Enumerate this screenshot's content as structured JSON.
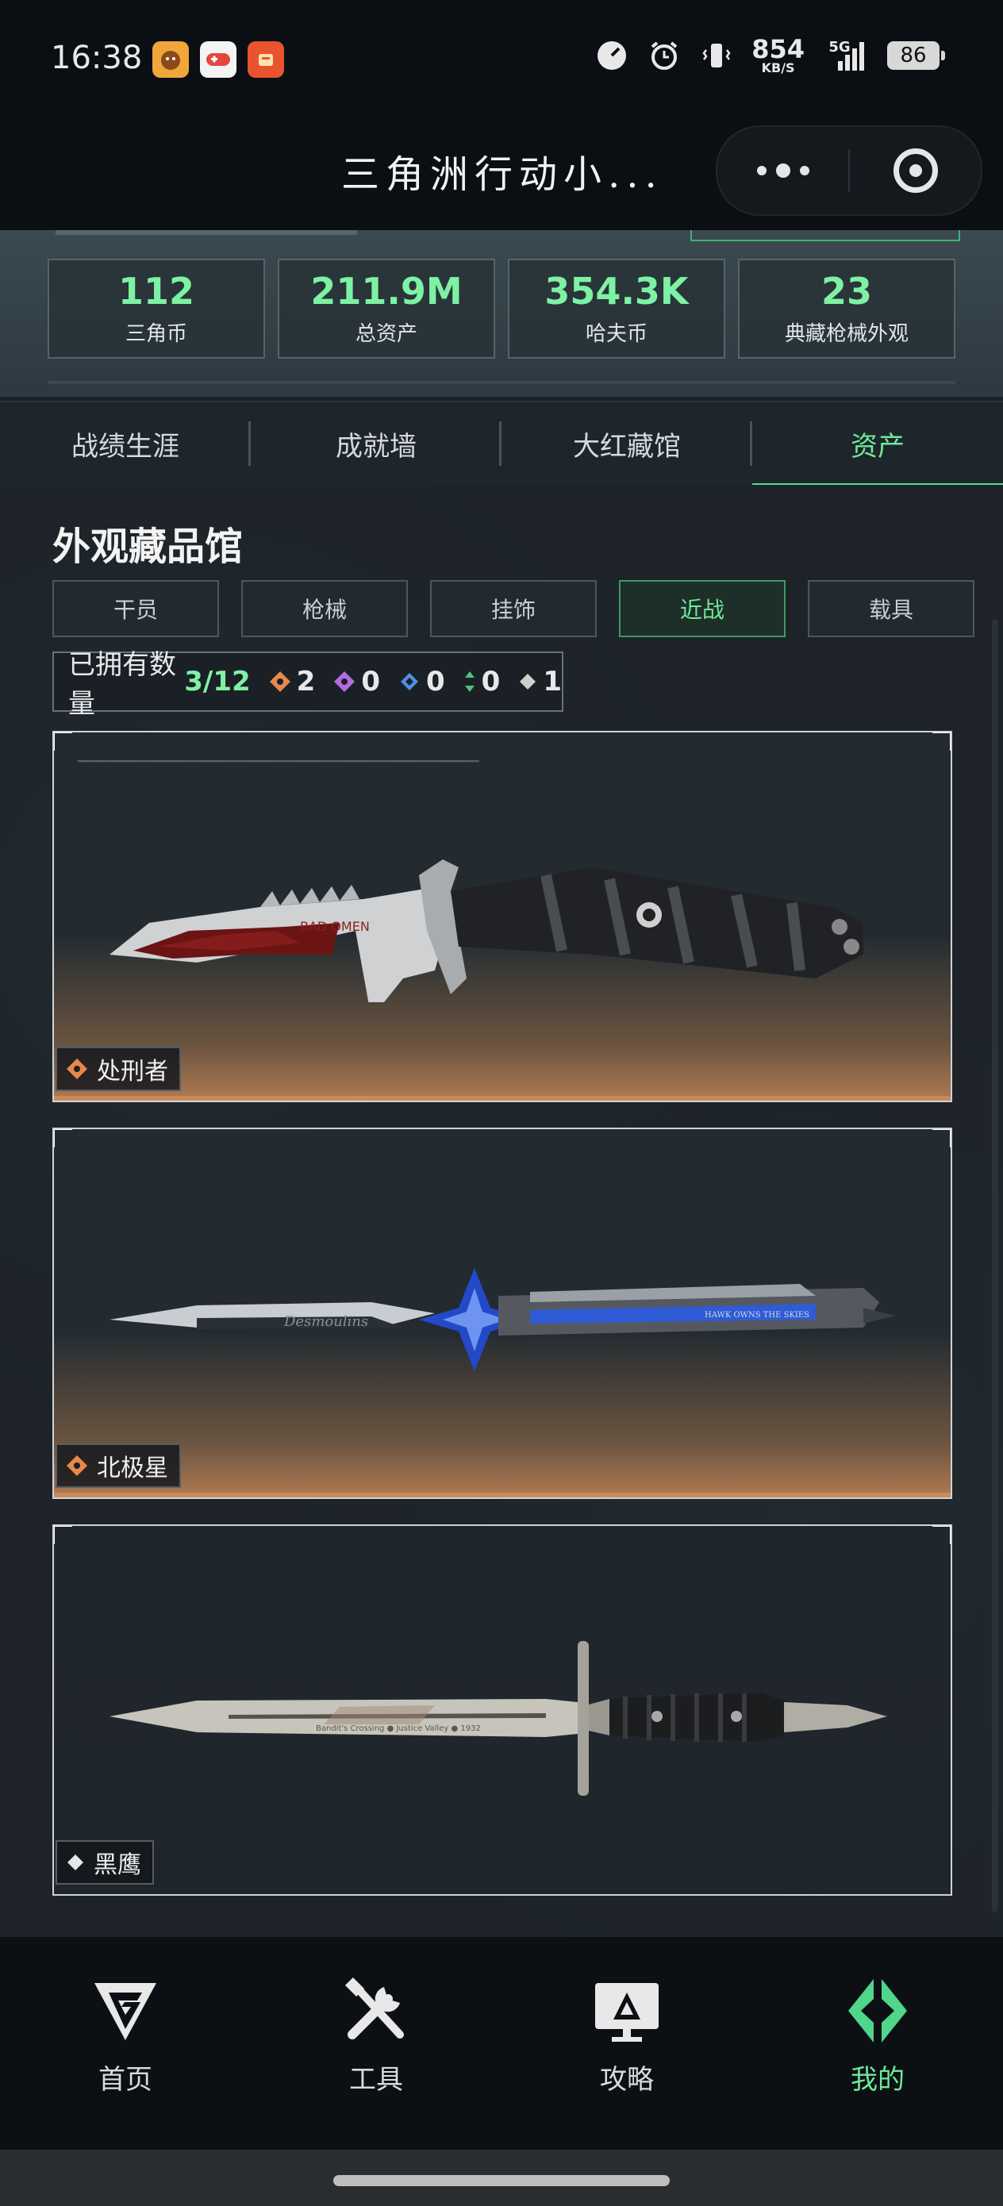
{
  "status_bar": {
    "time": "16:38",
    "network_speed_value": "854",
    "network_speed_unit": "KB/S",
    "network_type": "5G",
    "battery": "86",
    "icons": [
      "app-icon-1",
      "game-controller-icon",
      "app-icon-3",
      "speedometer-icon",
      "alarm-icon",
      "vibrate-icon",
      "signal-icon",
      "battery-icon"
    ]
  },
  "title_bar": {
    "title": "三角洲行动小..."
  },
  "summary": {
    "stats": [
      {
        "value": "112",
        "label": "三角币"
      },
      {
        "value": "211.9M",
        "label": "总资产"
      },
      {
        "value": "354.3K",
        "label": "哈夫币"
      },
      {
        "value": "23",
        "label": "典藏枪械外观"
      }
    ]
  },
  "tabs": [
    {
      "label": "战绩生涯",
      "active": false
    },
    {
      "label": "成就墙",
      "active": false
    },
    {
      "label": "大红藏馆",
      "active": false
    },
    {
      "label": "资产",
      "active": true
    }
  ],
  "collection": {
    "title": "外观藏品馆",
    "filters": [
      {
        "label": "干员",
        "active": false
      },
      {
        "label": "枪械",
        "active": false
      },
      {
        "label": "挂饰",
        "active": false
      },
      {
        "label": "近战",
        "active": true
      },
      {
        "label": "载具",
        "active": false
      }
    ],
    "owned_label": "已拥有数量",
    "owned_count": "3/12",
    "rarity_counts": [
      {
        "color": "#e8874b",
        "count": "2"
      },
      {
        "color": "#b56be0",
        "count": "0"
      },
      {
        "color": "#4f8fe6",
        "count": "0"
      },
      {
        "color": "#4ec27d",
        "count": "0"
      },
      {
        "color": "#cfcfcf",
        "count": "1"
      }
    ],
    "items": [
      {
        "name": "处刑者",
        "rarity_color": "#e8874b",
        "blade_text": "BAD OMEN"
      },
      {
        "name": "北极星",
        "rarity_color": "#e8874b",
        "blade_text": "Desmoulins",
        "handle_text": "HAWK OWNS THE SKIES"
      },
      {
        "name": "黑鹰",
        "rarity_color": "#e6e6e6",
        "blade_text": "Bandit's Crossing ● Justice Valley ● 1932"
      }
    ]
  },
  "bottom_nav": [
    {
      "label": "首页",
      "icon": "home-logo-icon",
      "active": false
    },
    {
      "label": "工具",
      "icon": "tools-icon",
      "active": false
    },
    {
      "label": "攻略",
      "icon": "guide-monitor-icon",
      "active": false
    },
    {
      "label": "我的",
      "icon": "profile-logo-icon",
      "active": true
    }
  ],
  "colors": {
    "accent_green": "#6fe89a",
    "background": "#1d2329",
    "orange_rarity": "#e8874b"
  }
}
